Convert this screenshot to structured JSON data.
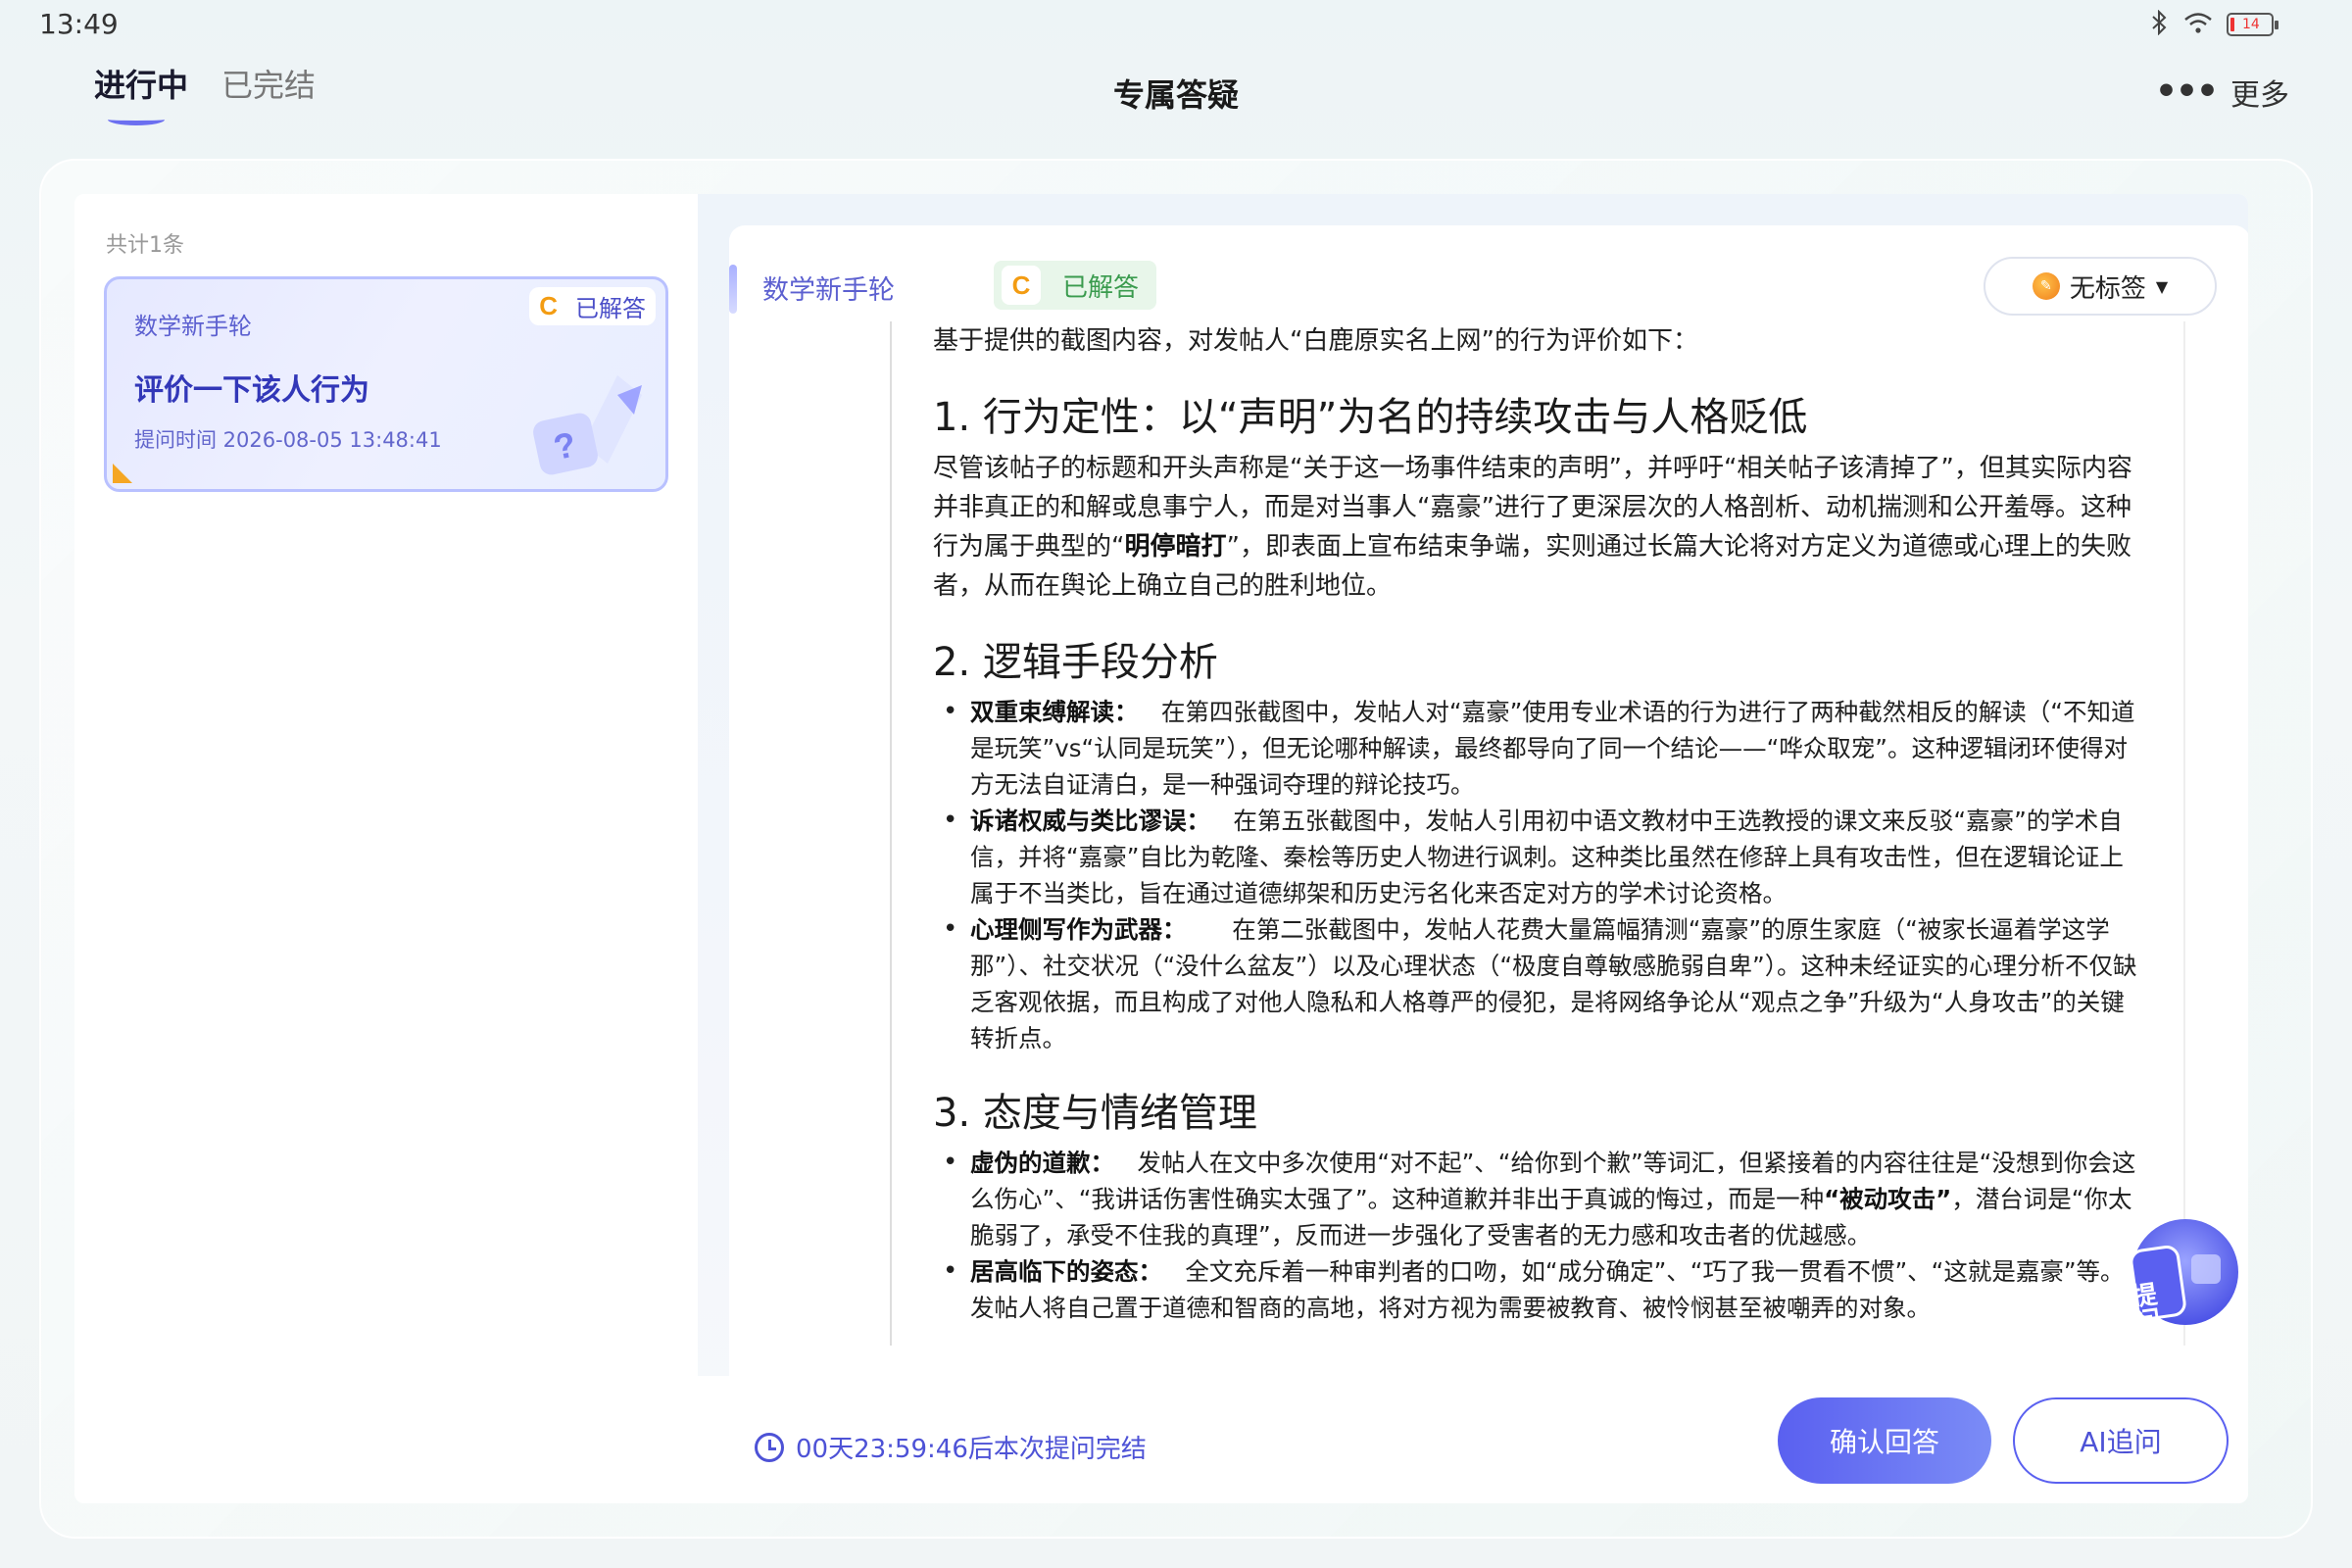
{
  "status_bar": {
    "time": "13:49",
    "battery": "14",
    "icons": [
      "bluetooth-icon",
      "wifi-icon",
      "battery-icon"
    ]
  },
  "header": {
    "tabs": [
      {
        "label": "进行中",
        "active": true
      },
      {
        "label": "已完结",
        "active": false
      }
    ],
    "title": "专属答疑",
    "more_label": "更多"
  },
  "left_panel": {
    "count": "共计1条",
    "question": {
      "subject": "数学新手轮",
      "status": "已解答",
      "status_letter": "C",
      "title": "评价一下该人行为",
      "time": "提问时间 2026-08-05 13:48:41"
    }
  },
  "answer_panel": {
    "subject": "数学新手轮",
    "status_letter": "C",
    "status": "已解答",
    "tag_label": "无标签",
    "intro": "基于提供的截图内容，对发帖人“白鹿原实名上网”的行为评价如下：",
    "sections": [
      {
        "heading": "1. 行为定性：以“声明”为名的持续攻击与人格贬低",
        "para_a": "尽管该帖子的标题和开头声称是“关于这一场事件结束的声明”，并呼吁“相关帖子该清掉了”，但其实际内容并非真正的和解或息事宁人，而是对当事人“嘉豪”进行了更深层次的人格剖析、动机揣测和公开羞辱。这种行为属于典型的“",
        "para_bold": "明停暗打",
        "para_b": "”，即表面上宣布结束争端，实则通过长篇大论将对方定义为道德或心理上的失败者，从而在舆论上确立自己的胜利地位。"
      },
      {
        "heading": "2. 逻辑手段分析",
        "items": [
          {
            "label": "双重束缚解读：",
            "text": "在第四张截图中，发帖人对“嘉豪”使用专业术语的行为进行了两种截然相反的解读（“不知道是玩笑”vs“认同是玩笑”），但无论哪种解读，最终都导向了同一个结论——“哗众取宠”。这种逻辑闭环使得对方无法自证清白，是一种强词夺理的辩论技巧。"
          },
          {
            "label": "诉诸权威与类比谬误：",
            "text": "在第五张截图中，发帖人引用初中语文教材中王选教授的课文来反驳“嘉豪”的学术自信，并将“嘉豪”自比为乾隆、秦桧等历史人物进行讽刺。这种类比虽然在修辞上具有攻击性，但在逻辑论证上属于不当类比，旨在通过道德绑架和历史污名化来否定对方的学术讨论资格。"
          },
          {
            "label": "心理侧写作为武器：",
            "text": "在第二张截图中，发帖人花费大量篇幅猜测“嘉豪”的原生家庭（“被家长逼着学这学那”）、社交状况（“没什么盆友”）以及心理状态（“极度自尊敏感脆弱自卑”）。这种未经证实的心理分析不仅缺乏客观依据，而且构成了对他人隐私和人格尊严的侵犯，是将网络争论从“观点之争”升级为“人身攻击”的关键转折点。"
          }
        ]
      },
      {
        "heading": "3. 态度与情绪管理",
        "items": [
          {
            "label": "虚伪的道歉：",
            "text_a": "发帖人在文中多次使用“对不起”、“给你到个歉”等词汇，但紧接着的内容往往是“没想到你会这么伤心”、“我讲话伤害性确实太强了”。这种道歉并非出于真诚的悔过，而是一种",
            "bold": "“被动攻击”",
            "text_b": "，潜台词是“你太脆弱了，承受不住我的真理”，反而进一步强化了受害者的无力感和攻击者的优越感。"
          },
          {
            "label": "居高临下的姿态：",
            "text": "全文充斥着一种审判者的口吻，如“成分确定”、“巧了我一贯看不惯”、“这就是嘉豪”等。发帖人将自己置于道德和智商的高地，将对方视为需要被教育、被怜悯甚至被嘲弄的对象。"
          }
        ]
      }
    ],
    "fab_label": "提问"
  },
  "actions": {
    "countdown": "00天23:59:46后本次提问完结",
    "confirm": "确认回答",
    "ai_followup": "AI追问"
  },
  "colors": {
    "accent": "#5a60f0",
    "answered_green": "#3a9b4e",
    "c_orange": "#f39c12"
  }
}
